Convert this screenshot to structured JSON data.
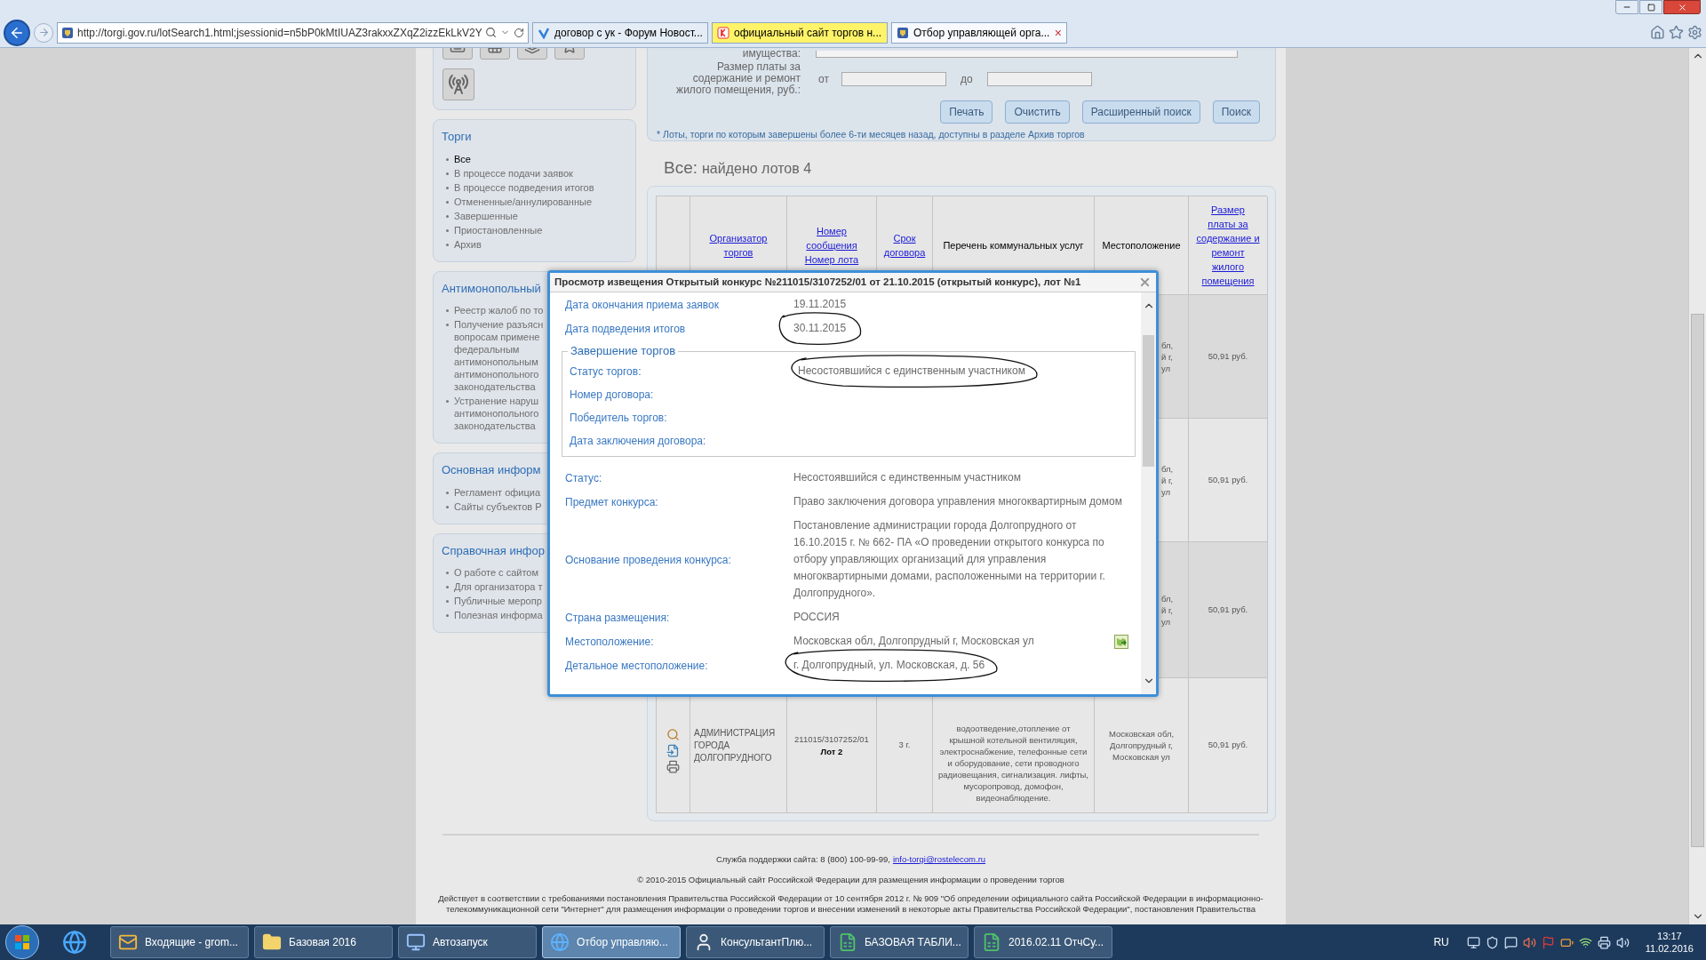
{
  "browser": {
    "url": "http://torgi.gov.ru/lotSearch1.html;jsessionid=n5bP0kMtIUAZ3rakxxZXqZ2izzEkLkV2Y",
    "tabs": [
      {
        "title": "договор с ук - Форум Новост...",
        "selected": false,
        "kind": "forum"
      },
      {
        "title": "официальный сайт торгов н...",
        "selected": false,
        "kind": "search"
      },
      {
        "title": "Отбор управляющей орга...",
        "selected": true,
        "kind": "site"
      }
    ],
    "close_tab": "×"
  },
  "sidebar": {
    "panels": [
      {
        "title": "Торги",
        "items": [
          {
            "label": "Все",
            "selected": true
          },
          {
            "label": "В процессе подачи заявок",
            "selected": false
          },
          {
            "label": "В процессе подведения итогов",
            "selected": false
          },
          {
            "label": "Отмененные/аннулированные",
            "selected": false
          },
          {
            "label": "Завершенные",
            "selected": false
          },
          {
            "label": "Приостановленные",
            "selected": false
          },
          {
            "label": "Архив",
            "selected": false
          }
        ]
      },
      {
        "title": "Антимонопольный",
        "items": [
          {
            "label": "Реестр жалоб по то",
            "selected": false
          },
          {
            "label": "Получение разъясн\nвопросам примене\nфедеральным\nантимонопольным\nантимонопольного\nзаконодательства",
            "selected": false
          },
          {
            "label": "Устранение наруш\nантимонопольного\nзаконодательства",
            "selected": false
          }
        ]
      },
      {
        "title": "Основная информ",
        "items": [
          {
            "label": "Регламент официа",
            "selected": false
          },
          {
            "label": "Сайты субъектов Р",
            "selected": false
          }
        ]
      },
      {
        "title": "Справочная инфор",
        "items": [
          {
            "label": "О работе с сайтом",
            "selected": false
          },
          {
            "label": "Для организатора т",
            "selected": false
          },
          {
            "label": "Публичные меропр",
            "selected": false
          },
          {
            "label": "Полезная информа",
            "selected": false
          }
        ]
      }
    ]
  },
  "search_form": {
    "property_label": "имущества:",
    "fee_label": "Размер платы за\nсодержание и ремонт\nжилого помещения, руб.:",
    "from_label": "от",
    "to_label": "до",
    "buttons": [
      "Печать",
      "Очистить",
      "Расширенный поиск",
      "Поиск"
    ],
    "note": "* Лоты, торги по которым завершены более 6-ти месяцев назад, доступны в разделе Архив торгов"
  },
  "results": {
    "heading_prefix": "Все:",
    "heading": "найдено лотов 4",
    "columns": [
      {
        "label": "Организатор\nторгов",
        "link": true
      },
      {
        "label": "Номер\nсообщения\nНомер лота",
        "link": true
      },
      {
        "label": "Срок\nдоговора",
        "link": true
      },
      {
        "label": "Перечень коммунальных услуг",
        "link": false
      },
      {
        "label": "Местоположение",
        "link": false
      },
      {
        "label": "Размер\nплаты за\nсодержание и\nремонт\nжилого\nпомещения",
        "link": true
      }
    ],
    "rows": [
      {
        "location": "бл,\nй г,\nул",
        "price": "50,91 руб."
      },
      {
        "location": "бл,\nй г,\nул",
        "price": "50,91 руб."
      },
      {
        "location": "бл,\nй г,\nул",
        "price": "50,91 руб."
      },
      {
        "organizer": "АДМИНИСТРАЦИЯ ГОРОДА ДОЛГОПРУДНОГО",
        "number": "211015/3107252/01",
        "lot": "Лот 2",
        "term": "3 г.",
        "services": "водоотведение,отопление от крышной котельной вентиляция, электроснабжение, телефонные сети и оборудование, сети проводного радиовещания, сигнализация. лифты, мусоропровод, домофон, видеонаблюдение.",
        "location": "Московская обл, Долгопрудный г, Московская ул",
        "price": "50,91 руб."
      }
    ]
  },
  "dialog": {
    "title": "Просмотр извещения Открытый конкурс №211015/3107252/01 от 21.10.2015 (открытый конкурс), лот №1",
    "sections": [
      {
        "kind": "rows",
        "fields": [
          {
            "label": "Дата окончания приема заявок",
            "value": "19.11.2015",
            "circled": false
          },
          {
            "label": "Дата подведения итогов",
            "value": "30.11.2015",
            "circled": true
          }
        ]
      },
      {
        "kind": "group",
        "legend": "Завершение торгов",
        "fields": [
          {
            "label": "Статус торгов:",
            "value": "Несостоявшийся с единственным участником",
            "circled": true
          },
          {
            "label": "Номер договора:"
          },
          {
            "label": "Победитель торгов:"
          },
          {
            "label": "Дата заключения договора:"
          }
        ]
      },
      {
        "kind": "rows",
        "fields": [
          {
            "label": "Статус:",
            "value": "Несостоявшийся с единственным участником",
            "circled": false
          },
          {
            "label": "Предмет конкурса:",
            "value": "Право заключения договора управления многоквартирным домом",
            "circled": false
          },
          {
            "label": "Основание проведения конкурса:",
            "value": "Постановление администрации города Долгопрудного от 16.10.2015 г. № 662- ПА «О проведении открытого конкурса по отбору управляющих организаций для управления многоквартирными домами, расположенными на территории г. Долгопрудного».",
            "circled": false
          },
          {
            "label": "Страна размещения:",
            "value": "РОССИЯ",
            "circled": false
          },
          {
            "label": "Местоположение:",
            "value": "Московская обл, Долгопрудный г, Московская ул",
            "circled": false,
            "map_link": true
          },
          {
            "label": "Детальное местоположение:",
            "value": "г. Долгопрудный, ул. Московская, д. 56",
            "circled": true
          }
        ]
      }
    ]
  },
  "footer": {
    "support": "Служба поддержки сайта: 8 (800) 100-99-99,",
    "email": "info-torgi@rostelecom.ru",
    "copyright": "© 2010-2015 Официальный сайт Российской Федерации для размещения информации о проведении торгов",
    "legal": [
      "Действует в соответствии с требованиями постановления Правительства Российской Федерации от 10 сентября 2012 г. № 909 \"Об определении официального сайта Российской Федерации в информационно-",
      "телекоммуникационной сети \"Интернет\" для размещения информации о проведении торгов и внесении изменений в некоторые акты Правительства Российской Федерации\", постановления Правительства"
    ]
  },
  "taskbar": {
    "tasks": [
      {
        "label": "Входящие - grom...",
        "selected": false,
        "kind": "mail"
      },
      {
        "label": "Базовая 2016",
        "selected": false,
        "kind": "folder"
      },
      {
        "label": "Автозапуск",
        "selected": false,
        "kind": "monitor"
      },
      {
        "label": "Отбор управляю...",
        "selected": true,
        "kind": "browser"
      },
      {
        "label": "КонсультантПлю...",
        "selected": false,
        "kind": "person"
      },
      {
        "label": "БАЗОВАЯ ТАБЛИ...",
        "selected": false,
        "kind": "sheet"
      },
      {
        "label": "2016.02.11 ОтчСу...",
        "selected": false,
        "kind": "sheet"
      }
    ],
    "language": "RU",
    "time": "13:17",
    "date": "11.02.2016"
  }
}
